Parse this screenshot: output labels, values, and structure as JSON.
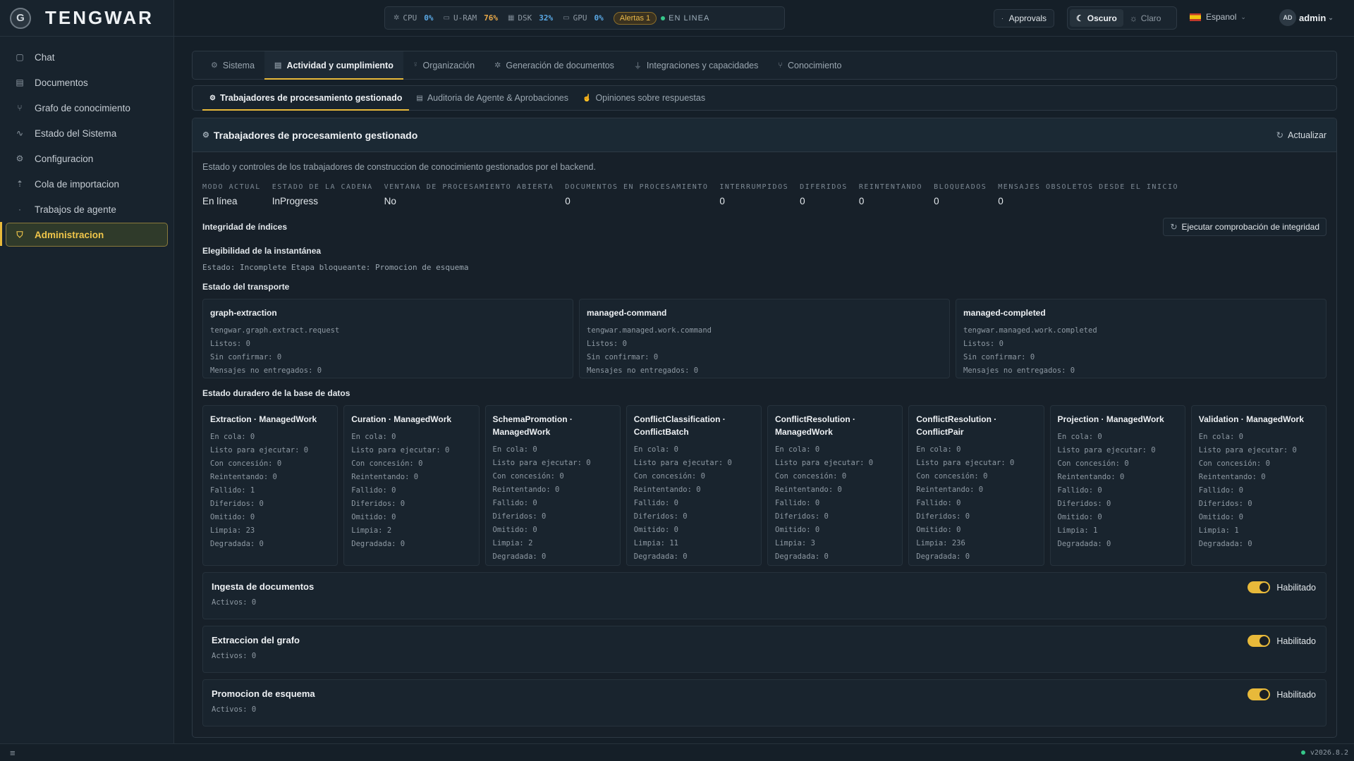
{
  "brand": {
    "logo": "G",
    "name": "TENGWAR"
  },
  "sidebar": {
    "items": [
      {
        "label": "Chat",
        "icon": "chat-icon",
        "glyph": "▢"
      },
      {
        "label": "Documentos",
        "icon": "document-icon",
        "glyph": "▤"
      },
      {
        "label": "Grafo de conocimiento",
        "icon": "graph-icon",
        "glyph": "⑂"
      },
      {
        "label": "Estado del Sistema",
        "icon": "activity-icon",
        "glyph": "∿"
      },
      {
        "label": "Configuracion",
        "icon": "gear-icon",
        "glyph": "⚙"
      },
      {
        "label": "Cola de importacion",
        "icon": "upload-icon",
        "glyph": "⇡"
      },
      {
        "label": "Trabajos de agente",
        "icon": "dot-icon",
        "glyph": "·"
      },
      {
        "label": "Administracion",
        "icon": "shield-icon",
        "glyph": "⛉"
      }
    ]
  },
  "topbar": {
    "metrics": [
      {
        "label": "CPU",
        "value": "0%",
        "icon": "cpu-icon",
        "glyph": "✲",
        "color": "#5aa9e6"
      },
      {
        "label": "U-RAM",
        "value": "76%",
        "icon": "memory-icon",
        "glyph": "▭",
        "color": "#e9a949"
      },
      {
        "label": "DSK",
        "value": "32%",
        "icon": "disk-icon",
        "glyph": "▦",
        "color": "#5aa9e6"
      },
      {
        "label": "GPU",
        "value": "0%",
        "icon": "gpu-icon",
        "glyph": "▭",
        "color": "#5aa9e6"
      }
    ],
    "alerts": "Alertas 1",
    "online": "EN LINEA",
    "approvals": "Approvals",
    "theme_dark": "Oscuro",
    "theme_light": "Claro",
    "language": "Espanol",
    "avatar": "AD",
    "user": "admin"
  },
  "tabs": [
    {
      "label": "Sistema",
      "icon": "gear-icon",
      "glyph": "⚙"
    },
    {
      "label": "Actividad y cumplimiento",
      "icon": "clipboard-icon",
      "glyph": "▤"
    },
    {
      "label": "Organización",
      "icon": "user-icon",
      "glyph": "⍤"
    },
    {
      "label": "Generación de documentos",
      "icon": "sparkle-icon",
      "glyph": "✲"
    },
    {
      "label": "Integraciones y capacidades",
      "icon": "plug-icon",
      "glyph": "⏚"
    },
    {
      "label": "Conocimiento",
      "icon": "graph-icon",
      "glyph": "⑂"
    }
  ],
  "subtabs": [
    {
      "label": "Trabajadores de procesamiento gestionado",
      "icon": "gear-icon",
      "glyph": "⚙"
    },
    {
      "label": "Auditoria de Agente & Aprobaciones",
      "icon": "clipboard-icon",
      "glyph": "▤"
    },
    {
      "label": "Opiniones sobre respuestas",
      "icon": "thumbs-up-icon",
      "glyph": "☝"
    }
  ],
  "panel": {
    "title": "Trabajadores de procesamiento gestionado",
    "refresh": "Actualizar",
    "description": "Estado y controles de los trabajadores de construccion de conocimiento gestionados por el backend.",
    "stats": [
      {
        "label": "MODO ACTUAL",
        "value": "En línea"
      },
      {
        "label": "ESTADO DE LA CADENA",
        "value": "InProgress"
      },
      {
        "label": "VENTANA DE PROCESAMIENTO ABIERTA",
        "value": "No"
      },
      {
        "label": "DOCUMENTOS EN PROCESAMIENTO",
        "value": "0"
      },
      {
        "label": "INTERRUMPIDOS",
        "value": "0"
      },
      {
        "label": "DIFERIDOS",
        "value": "0"
      },
      {
        "label": "REINTENTANDO",
        "value": "0"
      },
      {
        "label": "BLOQUEADOS",
        "value": "0"
      },
      {
        "label": "MENSAJES OBSOLETOS DESDE EL INICIO",
        "value": "0"
      }
    ],
    "integrity_title": "Integridad de índices",
    "integrity_button": "Ejecutar comprobación de integridad",
    "snapshot_title": "Elegibilidad de la instantánea",
    "snapshot_status": "Estado: Incomplete Etapa bloqueante: Promocion de esquema",
    "transport_title": "Estado del transporte",
    "transport": [
      {
        "name": "graph-extraction",
        "topic": "tengwar.graph.extract.request",
        "lines": [
          "Listos: 0",
          "Sin confirmar: 0",
          "Mensajes no entregados: 0"
        ]
      },
      {
        "name": "managed-command",
        "topic": "tengwar.managed.work.command",
        "lines": [
          "Listos: 0",
          "Sin confirmar: 0",
          "Mensajes no entregados: 0"
        ]
      },
      {
        "name": "managed-completed",
        "topic": "tengwar.managed.work.completed",
        "lines": [
          "Listos: 0",
          "Sin confirmar: 0",
          "Mensajes no entregados: 0"
        ]
      }
    ],
    "db_title": "Estado duradero de la base de datos",
    "db": [
      {
        "name": "Extraction · ManagedWork",
        "lines": [
          "En cola: 0",
          "Listo para ejecutar: 0",
          "Con concesión: 0",
          "Reintentando: 0",
          "Fallido: 1",
          "Diferidos: 0",
          "Omitido: 0",
          "Limpia: 23",
          "Degradada: 0"
        ]
      },
      {
        "name": "Curation · ManagedWork",
        "lines": [
          "En cola: 0",
          "Listo para ejecutar: 0",
          "Con concesión: 0",
          "Reintentando: 0",
          "Fallido: 0",
          "Diferidos: 0",
          "Omitido: 0",
          "Limpia: 2",
          "Degradada: 0"
        ]
      },
      {
        "name": "SchemaPromotion · ManagedWork",
        "lines": [
          "En cola: 0",
          "Listo para ejecutar: 0",
          "Con concesión: 0",
          "Reintentando: 0",
          "Fallido: 0",
          "Diferidos: 0",
          "Omitido: 0",
          "Limpia: 2",
          "Degradada: 0"
        ]
      },
      {
        "name": "ConflictClassification · ConflictBatch",
        "lines": [
          "En cola: 0",
          "Listo para ejecutar: 0",
          "Con concesión: 0",
          "Reintentando: 0",
          "Fallido: 0",
          "Diferidos: 0",
          "Omitido: 0",
          "Limpia: 11",
          "Degradada: 0"
        ]
      },
      {
        "name": "ConflictResolution · ManagedWork",
        "lines": [
          "En cola: 0",
          "Listo para ejecutar: 0",
          "Con concesión: 0",
          "Reintentando: 0",
          "Fallido: 0",
          "Diferidos: 0",
          "Omitido: 0",
          "Limpia: 3",
          "Degradada: 0"
        ]
      },
      {
        "name": "ConflictResolution · ConflictPair",
        "lines": [
          "En cola: 0",
          "Listo para ejecutar: 0",
          "Con concesión: 0",
          "Reintentando: 0",
          "Fallido: 0",
          "Diferidos: 0",
          "Omitido: 0",
          "Limpia: 236",
          "Degradada: 0"
        ]
      },
      {
        "name": "Projection · ManagedWork",
        "lines": [
          "En cola: 0",
          "Listo para ejecutar: 0",
          "Con concesión: 0",
          "Reintentando: 0",
          "Fallido: 0",
          "Diferidos: 0",
          "Omitido: 0",
          "Limpia: 1",
          "Degradada: 0"
        ]
      },
      {
        "name": "Validation · ManagedWork",
        "lines": [
          "En cola: 0",
          "Listo para ejecutar: 0",
          "Con concesión: 0",
          "Reintentando: 0",
          "Fallido: 0",
          "Diferidos: 0",
          "Omitido: 0",
          "Limpia: 1",
          "Degradada: 0"
        ]
      }
    ],
    "ingest": [
      {
        "title": "Ingesta de documentos",
        "sub": "Activos: 0",
        "toggle": "Habilitado",
        "enabled": true
      },
      {
        "title": "Extraccion del grafo",
        "sub": "Activos: 0",
        "toggle": "Habilitado",
        "enabled": true
      },
      {
        "title": "Promocion de esquema",
        "sub": "Activos: 0",
        "toggle": "Habilitado",
        "enabled": true
      }
    ]
  },
  "statusbar": {
    "menu": "≡",
    "version": "v2026.8.2"
  },
  "colors": {
    "accent": "#e8b93a",
    "online": "#36c78a",
    "background": "#151f28"
  }
}
